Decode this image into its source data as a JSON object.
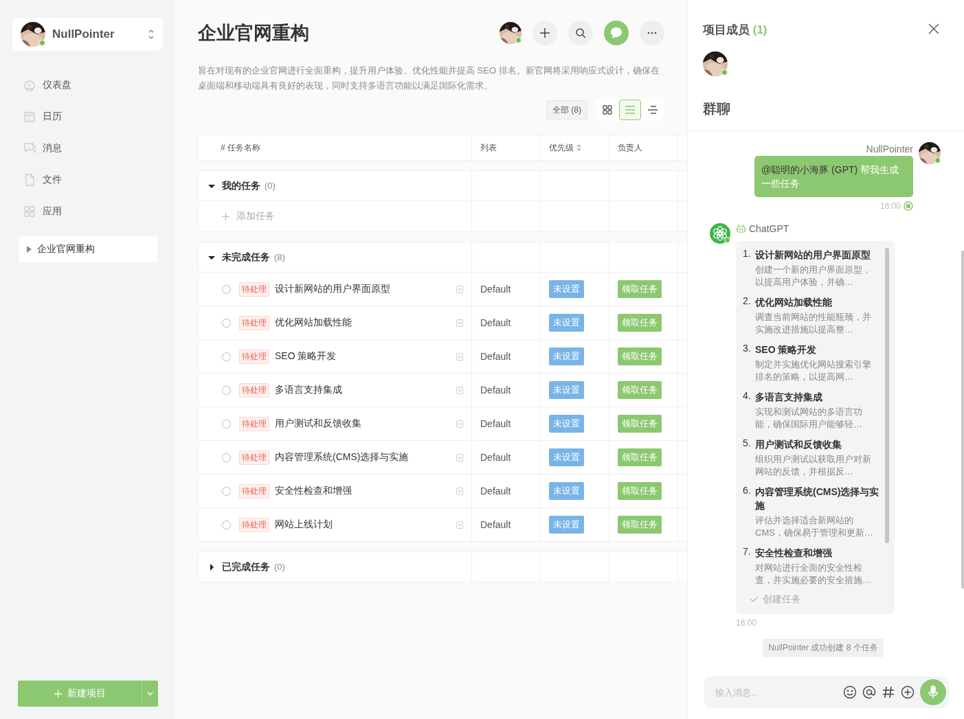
{
  "sidebar": {
    "user": {
      "name": "NullPointer",
      "online": true
    },
    "nav": [
      {
        "label": "仪表盘",
        "selected": false
      },
      {
        "label": "日历",
        "selected": false
      },
      {
        "label": "消息",
        "selected": false
      },
      {
        "label": "文件",
        "selected": false
      },
      {
        "label": "应用",
        "selected": false
      }
    ],
    "projects": [
      {
        "label": "企业官网重构",
        "selected": true,
        "expanded": false
      }
    ],
    "new_project_button": "新建项目"
  },
  "header": {
    "title": "企业官网重构",
    "owner_online": true,
    "chat_open": true,
    "description": "旨在对现有的企业官网进行全面重构，提升用户体验、优化性能并提高 SEO 排名。新官网将采用响应式设计，确保在桌面端和移动端具有良好的表现，同时支持多语言功能以满足国际化需求。",
    "filter": "全部 (8)",
    "views": [
      {
        "kind": "grid",
        "selected": false
      },
      {
        "kind": "list",
        "selected": true
      },
      {
        "kind": "outline",
        "selected": false
      }
    ]
  },
  "table": {
    "columns": [
      {
        "label": "# 任务名称",
        "sortable": false
      },
      {
        "label": "列表",
        "sortable": false
      },
      {
        "label": "优先级",
        "sortable": true
      },
      {
        "label": "负责人",
        "sortable": false
      }
    ],
    "groups": [
      {
        "title": "我的任务",
        "count": "(0)",
        "expanded": true,
        "add_label": "添加任务"
      },
      {
        "title": "未完成任务",
        "count": "(8)",
        "expanded": true,
        "tasks": [
          {
            "checked": false,
            "status": "待处理",
            "name": "设计新网站的用户界面原型",
            "list": "Default",
            "priority": "未设置",
            "assignee": "领取任务"
          },
          {
            "checked": false,
            "status": "待处理",
            "name": "优化网站加载性能",
            "list": "Default",
            "priority": "未设置",
            "assignee": "领取任务"
          },
          {
            "checked": false,
            "status": "待处理",
            "name": "SEO 策略开发",
            "list": "Default",
            "priority": "未设置",
            "assignee": "领取任务"
          },
          {
            "checked": false,
            "status": "待处理",
            "name": "多语言支持集成",
            "list": "Default",
            "priority": "未设置",
            "assignee": "领取任务"
          },
          {
            "checked": false,
            "status": "待处理",
            "name": "用户测试和反馈收集",
            "list": "Default",
            "priority": "未设置",
            "assignee": "领取任务"
          },
          {
            "checked": false,
            "status": "待处理",
            "name": "内容管理系统(CMS)选择与实施",
            "list": "Default",
            "priority": "未设置",
            "assignee": "领取任务"
          },
          {
            "checked": false,
            "status": "待处理",
            "name": "安全性检查和增强",
            "list": "Default",
            "priority": "未设置",
            "assignee": "领取任务"
          },
          {
            "checked": false,
            "status": "待处理",
            "name": "网站上线计划",
            "list": "Default",
            "priority": "未设置",
            "assignee": "领取任务"
          }
        ]
      },
      {
        "title": "已完成任务",
        "count": "(0)",
        "expanded": false
      }
    ]
  },
  "panel": {
    "members_title": "项目成员",
    "members_count": "(1)",
    "members": [
      {
        "online": true
      }
    ],
    "chat_title": "群聊",
    "messages": [
      {
        "kind": "outgoing",
        "sender": "NullPointer",
        "online": true,
        "mention": "@聪明的小海豚 (GPT)",
        "text": "帮我生成一些任务",
        "time": "16:00",
        "read": true
      },
      {
        "kind": "bot",
        "sender": "ChatGPT",
        "online": true,
        "items": [
          {
            "number": "1.",
            "title": "设计新网站的用户界面原型",
            "desc": "创建一个新的用户界面原型，以提高用户体验，并确…"
          },
          {
            "number": "2.",
            "title": "优化网站加载性能",
            "desc": "调查当前网站的性能瓶颈，并实施改进措施以提高整…"
          },
          {
            "number": "3.",
            "title": "SEO 策略开发",
            "desc": "制定并实施优化网站搜索引擎排名的策略，以提高网…"
          },
          {
            "number": "4.",
            "title": "多语言支持集成",
            "desc": "实现和测试网站的多语言功能，确保国际用户能够轻…"
          },
          {
            "number": "5.",
            "title": "用户测试和反馈收集",
            "desc": "组织用户测试以获取用户对新网站的反馈，并根据反…"
          },
          {
            "number": "6.",
            "title": "内容管理系统(CMS)选择与实施",
            "desc": "评估并选择适合新网站的 CMS，确保易于管理和更新…"
          },
          {
            "number": "7.",
            "title": "安全性检查和增强",
            "desc": "对网站进行全面的安全性检查，并实施必要的安全措施…"
          }
        ],
        "action": "创建任务",
        "time": "16:00"
      },
      {
        "kind": "system",
        "text": "NullPointer 成功创建 8 个任务"
      }
    ],
    "input": {
      "placeholder": "输入消息..."
    }
  }
}
